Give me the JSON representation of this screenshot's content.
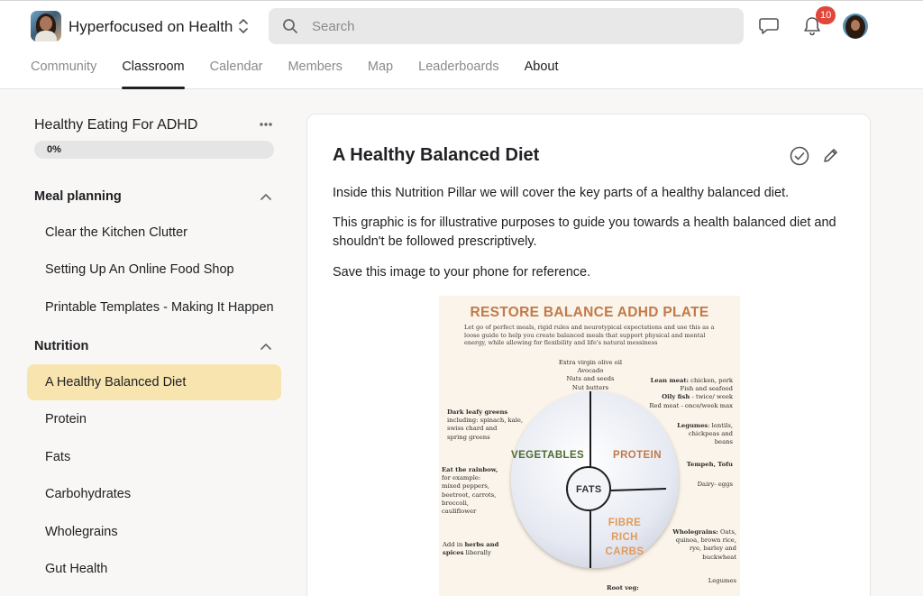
{
  "header": {
    "group_name": "Hyperfocused on Health",
    "search_placeholder": "Search",
    "notification_count": "10"
  },
  "nav": {
    "tabs": [
      {
        "label": "Community",
        "state": "inactive"
      },
      {
        "label": "Classroom",
        "state": "active"
      },
      {
        "label": "Calendar",
        "state": "inactive"
      },
      {
        "label": "Members",
        "state": "inactive"
      },
      {
        "label": "Map",
        "state": "inactive"
      },
      {
        "label": "Leaderboards",
        "state": "inactive"
      },
      {
        "label": "About",
        "state": "dark"
      }
    ]
  },
  "sidebar": {
    "course_title": "Healthy Eating For ADHD",
    "progress_label": "0%",
    "progress": 0,
    "sections": [
      {
        "title": "Meal planning",
        "lessons": [
          "Clear the Kitchen Clutter",
          "Setting Up An Online Food Shop",
          "Printable Templates - Making It Happen"
        ]
      },
      {
        "title": "Nutrition",
        "lessons": [
          "A Healthy Balanced Diet",
          "Protein",
          "Fats",
          "Carbohydrates",
          "Wholegrains",
          "Gut Health"
        ]
      }
    ],
    "active_lesson": "A Healthy Balanced Diet"
  },
  "lesson": {
    "title": "A Healthy Balanced Diet",
    "paragraphs": [
      "Inside this Nutrition Pillar we will cover the key parts of a healthy balanced diet.",
      "This graphic is for illustrative purposes to guide you towards a health balanced diet and shouldn't be followed prescriptively.",
      "Save this image to your phone for reference."
    ]
  },
  "infographic": {
    "title": "RESTORE BALANCE ADHD PLATE",
    "intro": "Let go of perfect meals, rigid rules and neurotypical expectations and use this as a loose guide to help you create balanced meals that support physical and mental energy, while allowing for flexibility and life's natural messiness",
    "top_fats": [
      "Extra virgin olive oil",
      "Avocado",
      "Nuts and seeds",
      "Nut butters"
    ],
    "lean_meat_label": "Lean meat:",
    "lean_meat_text": " chicken, pork",
    "fish": "Fish and seafood",
    "oily_fish_label": "Oily fish",
    "oily_fish_text": " - twice/ week",
    "red_meat": "Red meat - once/week max",
    "greens_label": "Dark leafy greens",
    "greens_text": [
      "including: spinach, kale,",
      "swiss chard and",
      "spring greens"
    ],
    "legumes_label": "Legumes",
    "legumes_text": [
      ": lentils,",
      "chickpeas and",
      "beans"
    ],
    "tempeh": "Tempeh, Tofu",
    "dairy": "Dairy- eggs",
    "rainbow_label": "Eat the rainbow,",
    "rainbow_text": [
      "for example:",
      "mixed peppers,",
      "beetroot, carrots,",
      "broccoli,",
      "cauliflower"
    ],
    "herbs_pre": "Add in ",
    "herbs_label": "herbs and",
    "spices_label": "spices",
    "herbs_post": " liberally",
    "wholegrains_label": "Wholegrains:",
    "wholegrains_text": [
      " Oats,",
      "quinoa, brown rice,",
      "rye, barley and",
      "buckwheat"
    ],
    "legumes_bottom": "Legumes",
    "root_veg_label": "Root veg:",
    "plate_labels": {
      "vegetables": "VEGETABLES",
      "protein": "PROTEIN",
      "fats": "FATS",
      "fibre": [
        "FIBRE",
        "RICH",
        "CARBS"
      ]
    },
    "colors": {
      "title": "#c17a4a",
      "vegetables": "#4e6b2f",
      "protein": "#c07a49",
      "fibre": "#e39a57"
    }
  },
  "colors": {
    "active_lesson_bg": "#f8e4ae",
    "badge": "#e0473a",
    "search_bg": "#e8e8e8"
  }
}
